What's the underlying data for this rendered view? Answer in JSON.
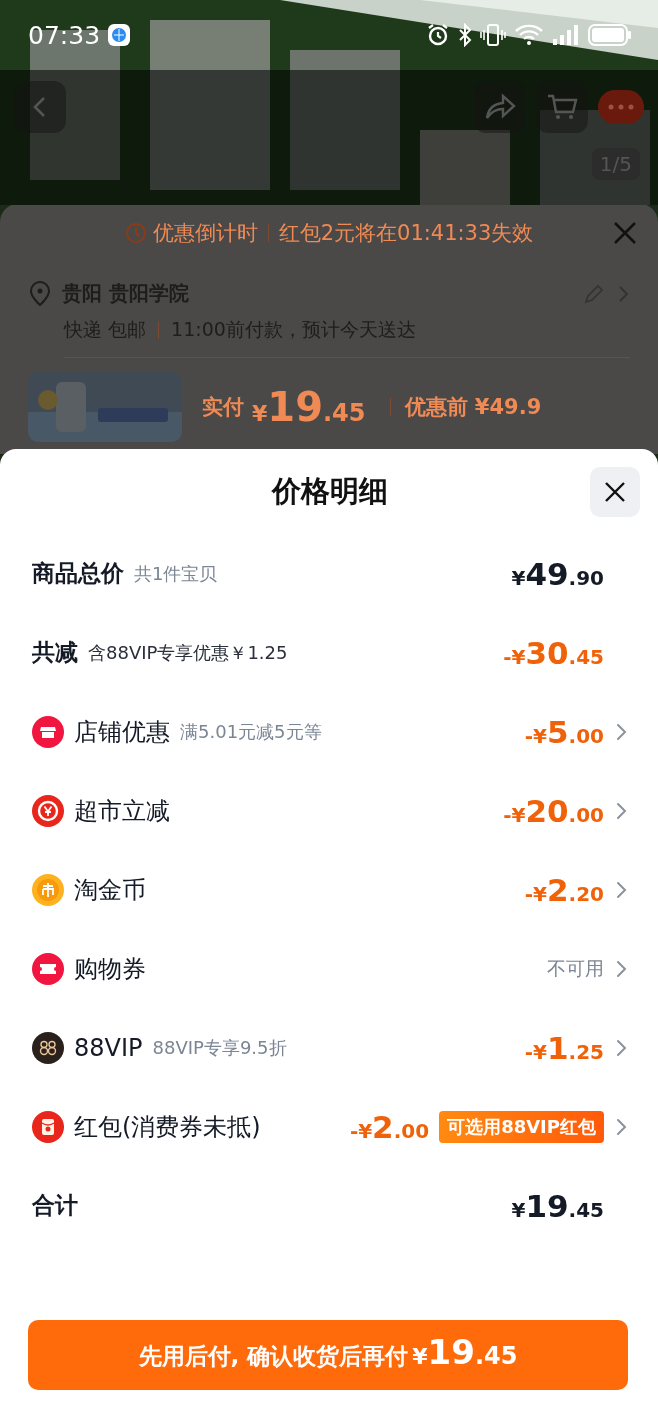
{
  "status_bar": {
    "time": "07:33"
  },
  "gallery": {
    "counter": "1/5"
  },
  "order_sheet": {
    "countdown": {
      "label": "优惠倒计时",
      "message": "红包2元将在01:41:33失效"
    },
    "address": {
      "title": "贵阳 贵阳学院",
      "shipping": "快递 包邮",
      "delivery": "11:00前付款，预计今天送达"
    },
    "product": {
      "pay_label": "实付",
      "pay_price": {
        "prefix": "¥",
        "main": "19",
        "cents": ".45"
      },
      "original_label": "优惠前",
      "original_price": "¥49.9"
    }
  },
  "price_detail": {
    "title": "价格明细",
    "rows": [
      {
        "kind": "summary",
        "label": "商品总价",
        "note": "共1件宝贝",
        "note_strong": false,
        "amount": {
          "prefix": "¥",
          "main": "49",
          "cents": ".90"
        },
        "highlight": false
      },
      {
        "kind": "summary",
        "label": "共减",
        "note": "含88VIP专享优惠￥1.25",
        "note_strong": true,
        "amount": {
          "prefix": "-¥",
          "main": "30",
          "cents": ".45"
        },
        "highlight": true
      },
      {
        "kind": "item",
        "label": "店铺优惠",
        "note": "满5.01元减5元等",
        "note_strong": false,
        "amount": {
          "prefix": "-¥",
          "main": "5",
          "cents": ".00"
        },
        "highlight": true
      },
      {
        "kind": "item",
        "label": "超市立减",
        "amount": {
          "prefix": "-¥",
          "main": "20",
          "cents": ".00"
        },
        "highlight": true
      },
      {
        "kind": "item",
        "label": "淘金币",
        "amount": {
          "prefix": "-¥",
          "main": "2",
          "cents": ".20"
        },
        "highlight": true
      },
      {
        "kind": "item",
        "label": "购物券",
        "status": "不可用"
      },
      {
        "kind": "item",
        "label": "88VIP",
        "note": "88VIP专享9.5折",
        "note_strong": false,
        "amount": {
          "prefix": "-¥",
          "main": "1",
          "cents": ".25"
        },
        "highlight": true
      },
      {
        "kind": "item",
        "label": "红包(消费券未抵)",
        "amount": {
          "prefix": "-¥",
          "main": "2",
          "cents": ".00"
        },
        "highlight": true,
        "badge": "可选用88VIP红包"
      },
      {
        "kind": "summary",
        "label": "合计",
        "amount": {
          "prefix": "¥",
          "main": "19",
          "cents": ".45"
        },
        "highlight": false
      }
    ],
    "pay_button": {
      "label": "先用后付, 确认收货后再付",
      "price": {
        "prefix": "¥",
        "main": "19",
        "cents": ".45"
      }
    }
  }
}
